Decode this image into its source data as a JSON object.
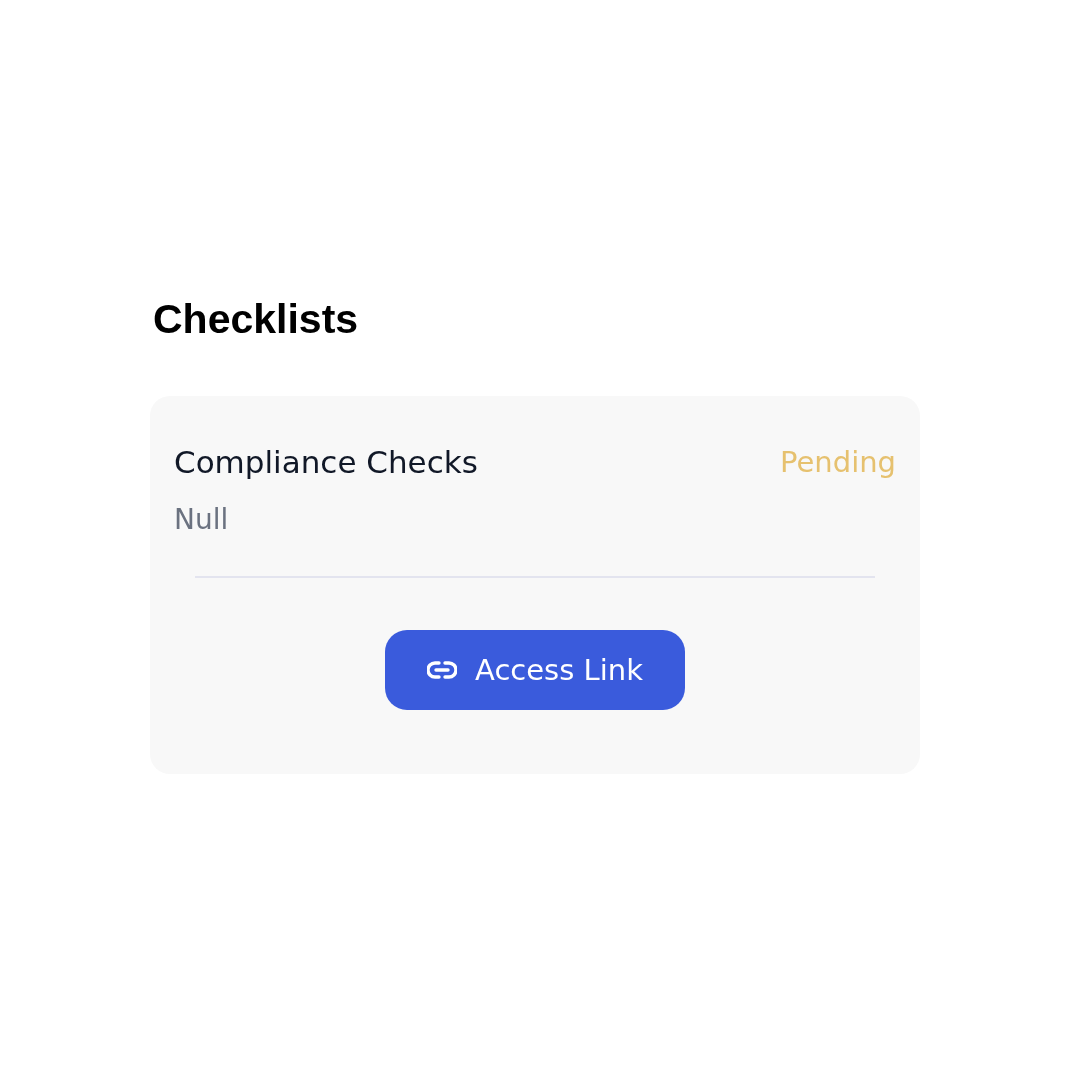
{
  "heading": "Checklists",
  "card": {
    "title": "Compliance Checks",
    "status": {
      "label": "Pending",
      "kind": "pending"
    },
    "description": "Null",
    "button": {
      "label": "Access Link"
    }
  }
}
